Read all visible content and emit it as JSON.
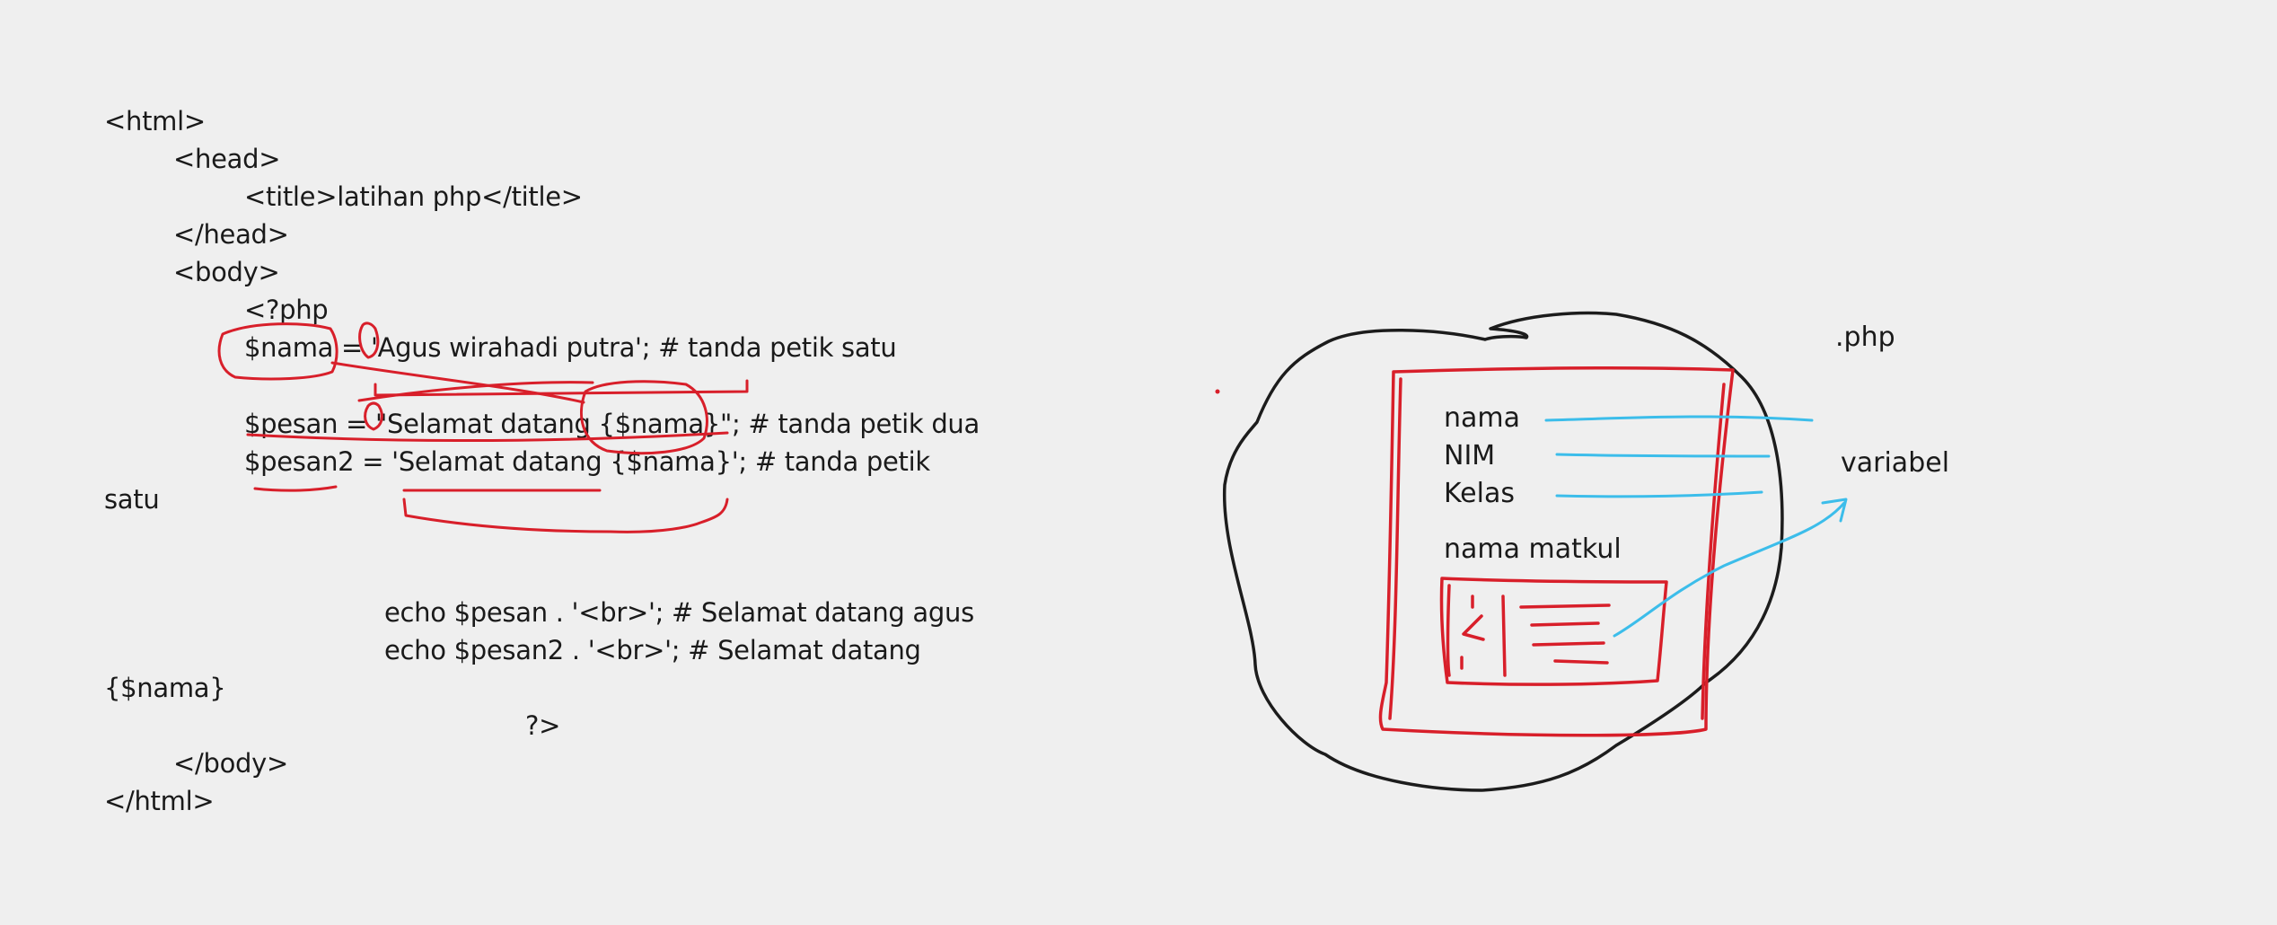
{
  "code": {
    "lines": [
      "<html>",
      "<head>",
      "<title>latihan php</title>",
      "</head>",
      "<body>",
      "<?php",
      "$nama = 'Agus wirahadi putra'; # tanda petik satu",
      "$pesan = \"Selamat datang {$nama}\"; # tanda petik dua",
      "$pesan2 = 'Selamat datang {$nama}'; # tanda petik",
      "satu",
      "echo $pesan . '<br>'; # Selamat datang agus",
      "echo $pesan2 . '<br>'; # Selamat datang",
      "{$nama}",
      "?>",
      "</body>",
      "</html>"
    ]
  },
  "sketch": {
    "fields": [
      "nama",
      "NIM",
      "Kelas"
    ],
    "section_label": "nama matkul",
    "ext_label": ".php",
    "variable_label": "variabel"
  },
  "colors": {
    "ink_black": "#1c1c1c",
    "ink_red": "#d81f2a",
    "ink_blue": "#3cbdea",
    "background": "#efefef"
  }
}
